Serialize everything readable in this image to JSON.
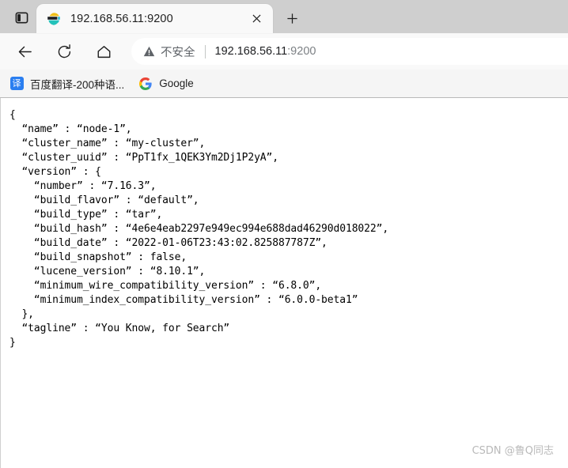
{
  "window": {
    "tab_actions_icon": "split-screen-icon",
    "new_tab_label": "+"
  },
  "tab": {
    "title": "192.168.56.11:9200",
    "favicon": "elasticsearch-logo-icon",
    "close_label": "×"
  },
  "toolbar": {
    "back_icon": "back-arrow-icon",
    "reload_icon": "reload-icon",
    "home_icon": "home-icon",
    "security_icon": "not-secure-warning-icon",
    "security_label": "不安全",
    "url_host": "192.168.56.11",
    "url_port": ":9200",
    "url_full": "192.168.56.11:9200"
  },
  "bookmarks": {
    "items": [
      {
        "label": "百度翻译-200种语...",
        "icon": "baidu-translate-icon",
        "glyph": "译"
      },
      {
        "label": "Google",
        "icon": "google-g-icon",
        "glyph": "G"
      }
    ]
  },
  "page": {
    "json_response": "{\n  “name” : “node-1”,\n  “cluster_name” : “my-cluster”,\n  “cluster_uuid” : “PpT1fx_1QEK3Ym2Dj1P2yA”,\n  “version” : {\n    “number” : “7.16.3”,\n    “build_flavor” : “default”,\n    “build_type” : “tar”,\n    “build_hash” : “4e6e4eab2297e949ec994e688dad46290d018022”,\n    “build_date” : “2022-01-06T23:43:02.825887787Z”,\n    “build_snapshot” : false,\n    “lucene_version” : “8.10.1”,\n    “minimum_wire_compatibility_version” : “6.8.0”,\n    “minimum_index_compatibility_version” : “6.0.0-beta1”\n  },\n  “tagline” : “You Know, for Search”\n}",
    "fields": {
      "name": "node-1",
      "cluster_name": "my-cluster",
      "cluster_uuid": "PpT1fx_1QEK3Ym2Dj1P2yA",
      "version_number": "7.16.3",
      "build_flavor": "default",
      "build_type": "tar",
      "build_hash": "4e6e4eab2297e949ec994e688dad46290d018022",
      "build_date": "2022-01-06T23:43:02.825887787Z",
      "build_snapshot": "false",
      "lucene_version": "8.10.1",
      "minimum_wire_compatibility_version": "6.8.0",
      "minimum_index_compatibility_version": "6.0.0-beta1",
      "tagline": "You Know, for Search"
    }
  },
  "watermark": {
    "text": "CSDN @鲁Q同志"
  },
  "colors": {
    "tabstrip_bg": "#cfcfcf",
    "tab_bg": "#f9f9f9",
    "toolbar_bg": "#f9f9f9",
    "bookmarks_bg": "#f5f5f5",
    "page_bg": "#ffffff",
    "baidu_blue": "#2a7ef0",
    "warn_gray": "#5f6368",
    "url_dark": "#202124",
    "watermark_gray": "#b9b9b9"
  }
}
